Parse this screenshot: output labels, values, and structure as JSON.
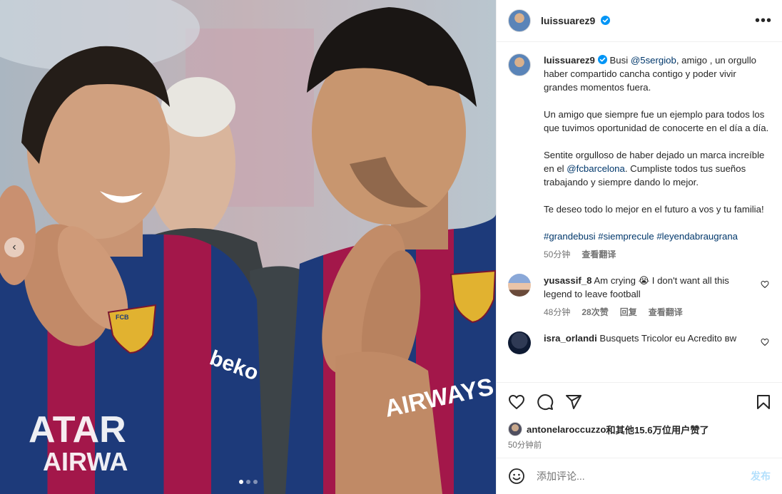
{
  "post": {
    "username": "luissuarez9",
    "more_icon": "more-options-icon",
    "media": {
      "description_icon": "photo",
      "carousel_dots": 3,
      "active_dot": 1,
      "jersey_sponsor_left": "QATAR AIRWAYS",
      "jersey_sponsor_right": "AIRWAYS",
      "sleeve_text": "beko",
      "crest_text": "FCB"
    },
    "caption": {
      "username": "luissuarez9",
      "p1_pre": "Busi ",
      "p1_mention": "@5sergiob",
      "p1_post": ", amigo , un orgullo haber compartido cancha contigo y poder vivir grandes momentos fuera.",
      "p2": "Un amigo que siempre fue un ejemplo para todos los que tuvimos oportunidad de conocerte en el día a día.",
      "p3_pre": "Sentite orgulloso de haber dejado un marca increíble en el ",
      "p3_mention": "@fcbarcelona",
      "p3_post": ". Cumpliste todos tus sueños trabajando y siempre dando lo mejor.",
      "p4": "Te deseo todo lo mejor en el futuro a vos y tu familia!",
      "hashtags": "#grandebusi #siemprecule #leyendabraugrana",
      "time": "50分钟",
      "translate": "查看翻译"
    },
    "comments": [
      {
        "username": "yusassif_8",
        "text_pre": " Am crying ",
        "emoji": "😭",
        "text_post": " I don't want all this legend to leave football",
        "time": "48分钟",
        "likes": "28次赞",
        "reply": "回复",
        "translate": "查看翻译"
      },
      {
        "username": "isra_orlandi",
        "text": " Busquets Tricolor eu Acredito ʙᴡ"
      }
    ],
    "likes": {
      "liker": "antonelaroccuzzo",
      "text": "和其他15.6万位用户赞了"
    },
    "timestamp": "50分钟前",
    "add_comment": {
      "placeholder": "添加评论...",
      "publish": "发布"
    },
    "colors": {
      "link": "#00376b",
      "verified": "#0095f6",
      "publish_disabled": "#b2dffc",
      "barca_blue": "#1d3a7a",
      "barca_red": "#a3174a"
    }
  }
}
